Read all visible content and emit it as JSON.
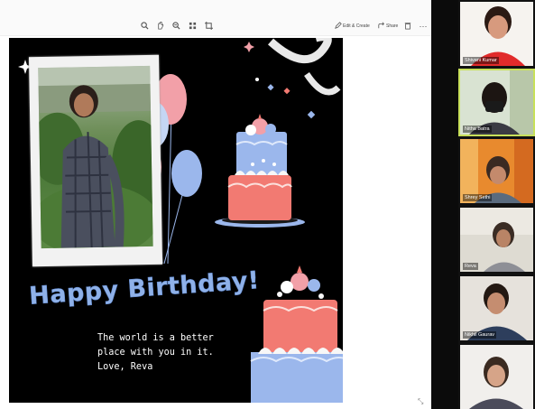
{
  "toolbar": {
    "icons": [
      "search-icon",
      "pan-icon",
      "zoom-icon",
      "grid-icon",
      "crop-icon"
    ],
    "edit_label": "Edit & Create",
    "share_label": "Share"
  },
  "slide": {
    "greeting": "Happy Birthday!",
    "message_line1": "The world is a better",
    "message_line2": "place with you in it.",
    "message_line3": "Love, Reva",
    "colors": {
      "background": "#000000",
      "pink": "#f2a0a8",
      "blue": "#9bb7ec",
      "coral": "#f27a72"
    }
  },
  "participants": [
    {
      "name": "Shivani Kumar"
    },
    {
      "name": "Nitha Batra"
    },
    {
      "name": "Shrey Sethi"
    },
    {
      "name": "Reva"
    },
    {
      "name": "Nikhil Gaurav"
    },
    {
      "name": ""
    }
  ]
}
